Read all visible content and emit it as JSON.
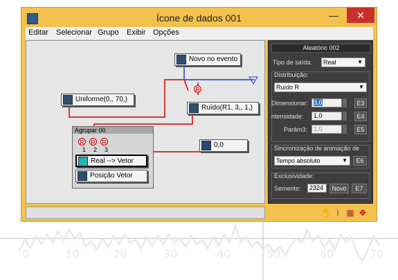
{
  "window": {
    "title": "Ícone de dados 001",
    "minimize": "—",
    "close": "✕"
  },
  "menu": [
    "Editar",
    "Selecionar",
    "Grupo",
    "Exibir",
    "Opções"
  ],
  "nodes": {
    "event": "Novo no evento",
    "uniform": "Uniforme(0,, 70,)",
    "noise": "Ruído(R1, 3,, 1,)",
    "zero": "0,0",
    "real_vector": "Real --> Vetor",
    "position_vector": "Posição Vetor"
  },
  "group": {
    "title": "Agrupar 00",
    "bubble": "R",
    "port_numbers": [
      "1",
      "2",
      "3"
    ]
  },
  "panel": {
    "title": "Aleatório 002",
    "output_type_label": "Tipo de saída:",
    "output_type_value": "Real",
    "distribution_label": "Distribuição:",
    "distribution_value": "Ruído R",
    "dimensions_label": "Dimensionar:",
    "dimensions_value": "3,0",
    "dimensions_btn": "E3",
    "intensity_label": "ntensidade:",
    "intensity_value": "1,0",
    "intensity_btn": "E4",
    "param3_label": "Parâm3:",
    "param3_value": "1,0",
    "param3_btn": "E5",
    "sync_label": "Sincronização de animação de",
    "sync_value": "Tempo absoluto",
    "sync_btn": "E6",
    "exclusivity_label": "Exclusividade:",
    "seed_label": "Semente:",
    "seed_value": "2324",
    "new_btn": "Novo",
    "seed_btn": "E7"
  },
  "background_axis": {
    "ticks": [
      "0",
      "10",
      "20",
      "30",
      "40",
      "50",
      "60",
      "70"
    ]
  },
  "colors": {
    "window_frame": "#f2c14e",
    "close_button": "#c9302c",
    "wire_red": "#cc0000",
    "wire_blue": "#1a3fcf",
    "panel_bg": "#3e3e3e"
  }
}
